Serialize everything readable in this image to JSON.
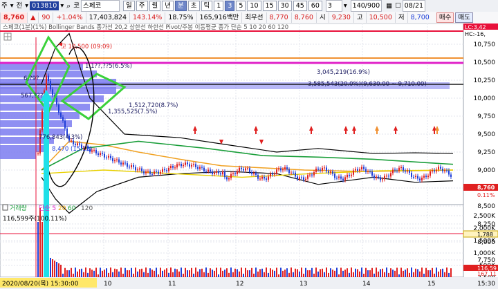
{
  "toolbar1": {
    "type_label": "주",
    "period_label": "전",
    "code": "013810",
    "market_label": "코",
    "stock_name": "스페코",
    "period_tabs": [
      "일",
      "주",
      "월",
      "년",
      "분",
      "초",
      "틱"
    ],
    "active_period": "분",
    "minute_options": [
      "1",
      "3",
      "5",
      "10",
      "15",
      "30",
      "45",
      "60"
    ],
    "active_minute": "3",
    "count_value": "3",
    "range_value": "140/900",
    "date_value": "08/21"
  },
  "toolbar2": {
    "price": "8,760",
    "change_symbol": "▲",
    "change": "90",
    "change_pct": "+1.04%",
    "volume": "17,403,824",
    "volume_ratio": "143.14%",
    "turnover": "18.75%",
    "amount": "165,916백만",
    "best_label": "최우선",
    "ask": "8,770",
    "bid": "8,760",
    "open_label": "시",
    "open": "9,230",
    "high_label": "고",
    "high": "10,500",
    "low_label": "저",
    "low": "8,700",
    "buy_button": "매수",
    "sell_button": "매도"
  },
  "legend": {
    "top_text": "스페코(1분)(1%)  Bollinger Bands  종가선 20,2  상한선  하한선  Pivot/주봉  이동평균  종가 단순 5 10 20 60 120",
    "volume_title": "거래량",
    "volume_ma": [
      "5",
      "20",
      "60",
      "120"
    ],
    "volume_ma_prefix": "단순",
    "volume_value": "116,599주(100.11%)"
  },
  "annotations": {
    "high_marker": "고 10,500 (09:09)",
    "low_marker": "8,470 (15:12)",
    "vp1": "1,1??,??5(6.5%)",
    "vp2": "3,045,219(16.9%)",
    "vp3": "3,585,543(20.0%)(9,630.00 ~ 9,710.00)",
    "vp4": "1,512,720(8.7%)",
    "vp5": "1,355,525(7.5%)",
    "vp6": "776,843(4.3%)",
    "vp7": "567,???",
    "vp8": "6,?9?"
  },
  "price_axis": {
    "labels": [
      "10,750",
      "10,500",
      "10,250",
      "10,000",
      "9,750",
      "9,500",
      "9,250",
      "9,000",
      "8,750",
      "8,500",
      "8,250",
      "8,000",
      "7,750",
      "7,500"
    ],
    "top_marker": "LC:3,42",
    "second_marker": "HC:-16,",
    "current_price_tag": "8,760",
    "pct_tag": "0.11%"
  },
  "volume_axis": {
    "labels": [
      "2,500K",
      "2,000K",
      "1,500K",
      "1,000K",
      "500K"
    ],
    "marker_tag": "1,788",
    "current_tag": "116,59",
    "base_tag": "167,11"
  },
  "time_axis": {
    "start_label": "2020/08/20(목) 15:30:00",
    "labels": [
      "10",
      "11",
      "12",
      "13",
      "14",
      "15"
    ],
    "end_label": "15:30"
  },
  "colors": {
    "bollinger_outer": "#000000",
    "ma_green": "#1a9e3a",
    "ma_orange": "#f0a020",
    "ma_yellow": "#e8d000",
    "candle_up": "#e02020",
    "candle_down": "#1f3fd8",
    "pivot_red": "#e8103a",
    "pivot_magenta": "#e020c8",
    "pivot_orange": "#f09030",
    "volume_profile": "#7b7bf0",
    "annotation_green": "#3ad13a",
    "annotation_cyan": "#1fe0e8"
  }
}
